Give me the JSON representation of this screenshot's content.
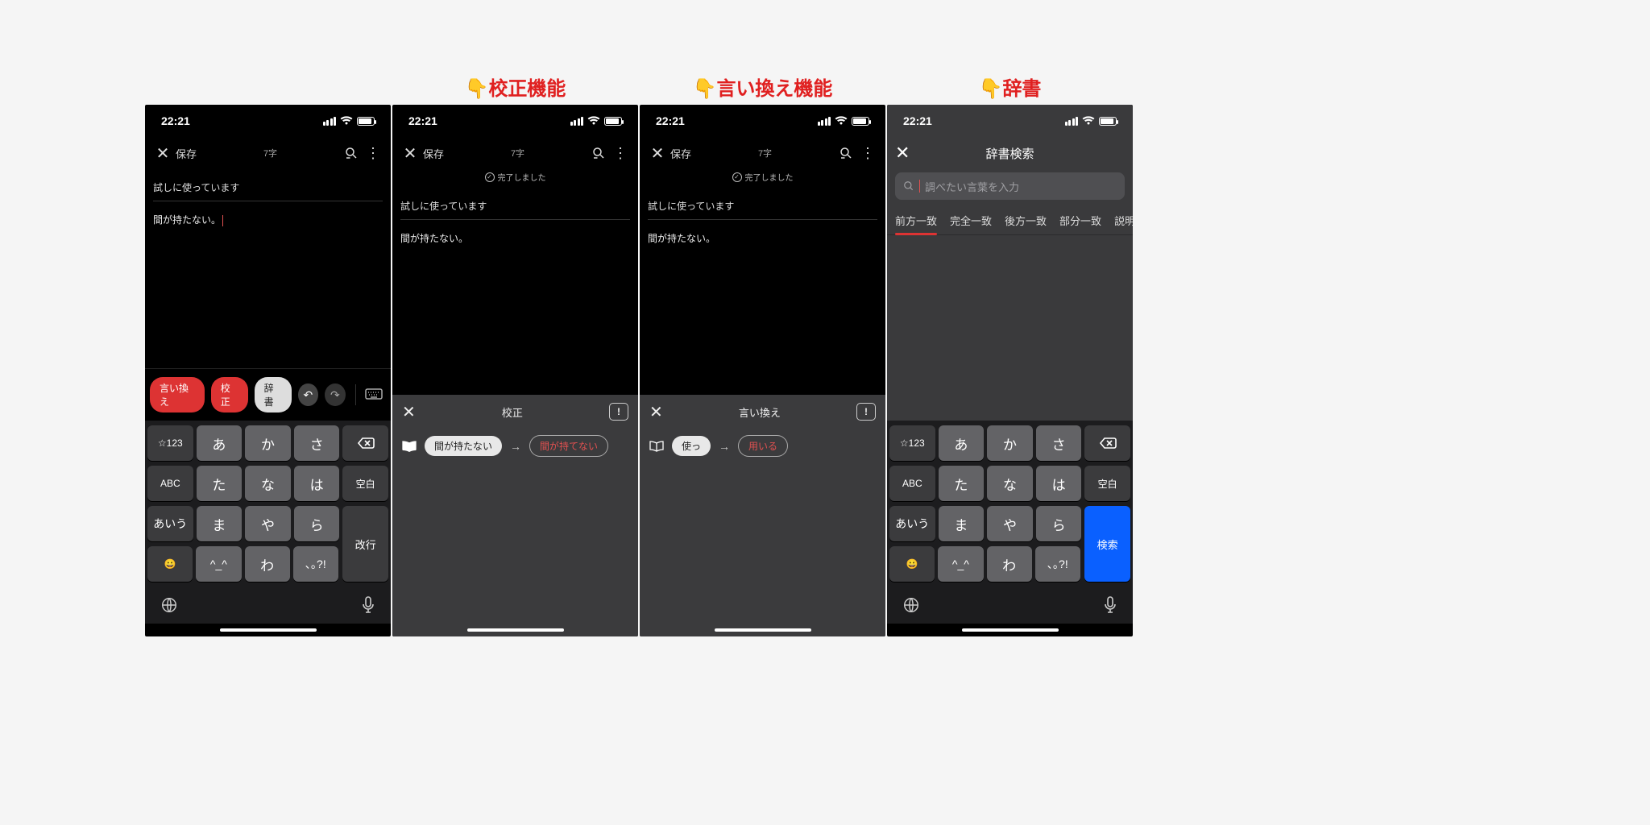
{
  "labels": {
    "s2": "校正機能",
    "s3": "言い換え機能",
    "s4": "辞書"
  },
  "status": {
    "time": "22:21"
  },
  "toolbar": {
    "save": "保存",
    "count": "7字"
  },
  "completed": "完了しました",
  "editor": {
    "title": "試しに使っています",
    "body": "間が持たない。"
  },
  "screen1": {
    "pills": {
      "rephrase": "言い換え",
      "proof": "校正",
      "dict": "辞書"
    }
  },
  "panel_proof": {
    "title": "校正",
    "from": "間が持たない",
    "to": "間が持てない"
  },
  "panel_rephrase": {
    "title": "言い換え",
    "from": "使っ",
    "to": "用いる"
  },
  "dict": {
    "title": "辞書検索",
    "placeholder": "調べたい言葉を入力",
    "tabs": [
      "前方一致",
      "完全一致",
      "後方一致",
      "部分一致",
      "説明文"
    ]
  },
  "kbd": {
    "r1": [
      "☆123",
      "あ",
      "か",
      "さ"
    ],
    "r2": [
      "ABC",
      "た",
      "な",
      "は",
      "空白"
    ],
    "r3": [
      "あいう",
      "ま",
      "や",
      "ら"
    ],
    "r4": [
      "😀",
      "^_^",
      "わ",
      "､｡?!"
    ],
    "enter_default": "改行",
    "enter_search": "検索"
  }
}
